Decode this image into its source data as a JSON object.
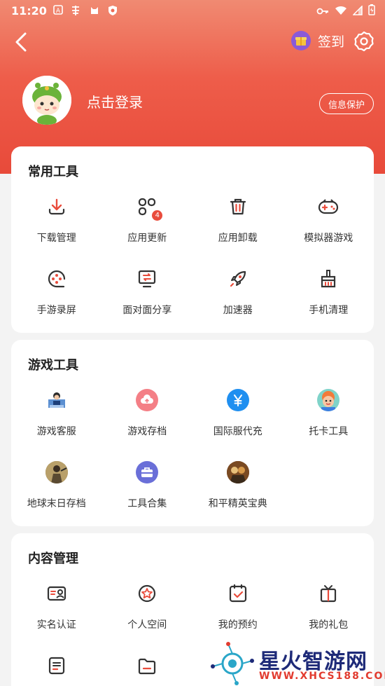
{
  "status_bar": {
    "time": "11:20",
    "left_icons": [
      "a-icon",
      "notification-icon",
      "cat-icon",
      "shield-icon"
    ],
    "right_icons": [
      "key-icon",
      "wifi-icon",
      "signal-icon",
      "battery-icon"
    ]
  },
  "header": {
    "signin_label": "签到",
    "login_label": "点击登录",
    "protect_label": "信息保护"
  },
  "sections": [
    {
      "title": "常用工具",
      "items": [
        {
          "label": "下载管理",
          "icon": "download-icon"
        },
        {
          "label": "应用更新",
          "icon": "app-update-icon",
          "badge": "4"
        },
        {
          "label": "应用卸载",
          "icon": "trash-icon"
        },
        {
          "label": "模拟器游戏",
          "icon": "gamepad-icon"
        },
        {
          "label": "手游录屏",
          "icon": "record-icon"
        },
        {
          "label": "面对面分享",
          "icon": "share-icon"
        },
        {
          "label": "加速器",
          "icon": "rocket-icon"
        },
        {
          "label": "手机清理",
          "icon": "broom-icon"
        }
      ]
    },
    {
      "title": "游戏工具",
      "items": [
        {
          "label": "游戏客服",
          "icon": "customer-service-icon"
        },
        {
          "label": "游戏存档",
          "icon": "cloud-save-icon"
        },
        {
          "label": "国际服代充",
          "icon": "yen-icon"
        },
        {
          "label": "托卡工具",
          "icon": "toca-icon"
        },
        {
          "label": "地球末日存档",
          "icon": "doomsday-icon"
        },
        {
          "label": "工具合集",
          "icon": "toolbox-icon"
        },
        {
          "label": "和平精英宝典",
          "icon": "pubg-icon"
        }
      ]
    },
    {
      "title": "内容管理",
      "items": [
        {
          "label": "实名认证",
          "icon": "id-card-icon"
        },
        {
          "label": "个人空间",
          "icon": "star-badge-icon"
        },
        {
          "label": "我的预约",
          "icon": "calendar-check-icon"
        },
        {
          "label": "我的礼包",
          "icon": "gift-box-icon"
        },
        {
          "label": "",
          "icon": "document-icon"
        },
        {
          "label": "",
          "icon": "folder-icon"
        }
      ]
    }
  ],
  "watermark": {
    "title": "星火智游网",
    "url": "WWW.XHCS188.COM"
  },
  "colors": {
    "accent": "#e94c3c",
    "header_top": "#f08a72",
    "header_bottom": "#e84a3a"
  }
}
